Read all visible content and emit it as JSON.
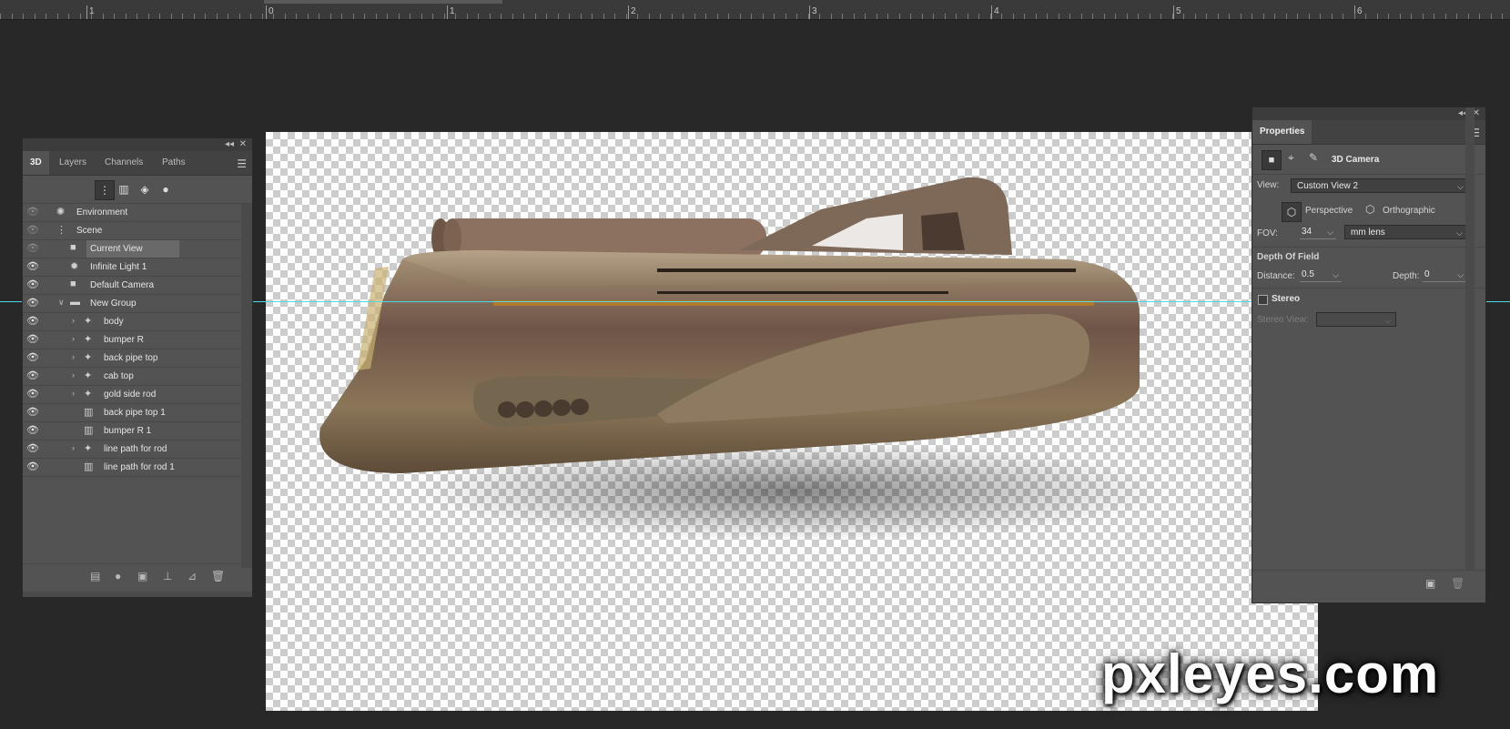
{
  "ruler": {
    "labels": [
      "1",
      "0",
      "1",
      "2",
      "3",
      "4",
      "5",
      "6"
    ]
  },
  "left_panel": {
    "tabs": [
      "3D",
      "Layers",
      "Channels",
      "Paths"
    ],
    "active_tab": "3D",
    "filter_icons": [
      "scene-filter-icon",
      "mesh-filter-icon",
      "material-filter-icon",
      "light-filter-icon"
    ],
    "layers": [
      {
        "name": "Environment",
        "icon": "environment-icon",
        "visible": "dim",
        "indent": 0,
        "expandable": false
      },
      {
        "name": "Scene",
        "icon": "scene-icon",
        "visible": "dim",
        "indent": 0,
        "expandable": false
      },
      {
        "name": "Current View",
        "icon": "camera-icon",
        "visible": "dim",
        "indent": 1,
        "expandable": false,
        "selected": true
      },
      {
        "name": "Infinite Light 1",
        "icon": "light-icon",
        "visible": "on",
        "indent": 1,
        "expandable": false
      },
      {
        "name": "Default Camera",
        "icon": "camera-icon",
        "visible": "on",
        "indent": 1,
        "expandable": false
      },
      {
        "name": "New Group",
        "icon": "folder-icon",
        "visible": "on",
        "indent": 1,
        "expandable": true,
        "expanded": true
      },
      {
        "name": "body",
        "icon": "mesh-icon",
        "visible": "on",
        "indent": 2,
        "expandable": true
      },
      {
        "name": "bumper R",
        "icon": "mesh-icon",
        "visible": "on",
        "indent": 2,
        "expandable": true
      },
      {
        "name": "back pipe top",
        "icon": "mesh-icon",
        "visible": "on",
        "indent": 2,
        "expandable": true
      },
      {
        "name": "cab top",
        "icon": "mesh-icon",
        "visible": "on",
        "indent": 2,
        "expandable": true
      },
      {
        "name": "gold side rod",
        "icon": "mesh-icon",
        "visible": "on",
        "indent": 2,
        "expandable": true
      },
      {
        "name": "back pipe top 1",
        "icon": "instance-icon",
        "visible": "on",
        "indent": 2,
        "expandable": false
      },
      {
        "name": "bumper R 1",
        "icon": "instance-icon",
        "visible": "on",
        "indent": 2,
        "expandable": false
      },
      {
        "name": "line path for rod",
        "icon": "mesh-icon",
        "visible": "on",
        "indent": 2,
        "expandable": true
      },
      {
        "name": "line path for rod 1",
        "icon": "instance-icon",
        "visible": "on",
        "indent": 2,
        "expandable": false
      }
    ],
    "bottom_icons": [
      "new-mesh-icon",
      "new-light-icon",
      "render-icon",
      "drop-to-plane-icon",
      "constraint-icon",
      "trash-icon"
    ]
  },
  "properties": {
    "tab": "Properties",
    "section_title": "3D Camera",
    "view_label": "View:",
    "view_value": "Custom View 2",
    "perspective_label": "Perspective",
    "orthographic_label": "Orthographic",
    "fov_label": "FOV:",
    "fov_value": "34",
    "lens_value": "mm lens",
    "dof_title": "Depth Of Field",
    "distance_label": "Distance:",
    "distance_value": "0.5",
    "depth_label": "Depth:",
    "depth_value": "0",
    "stereo_label": "Stereo",
    "stereo_view_label": "Stereo View:",
    "stereo_view_value": ""
  },
  "watermark": "pxleyes.com",
  "colors": {
    "background": "#282828",
    "panel": "#535353",
    "guide": "#4fd8e8",
    "selected_row": "#696969"
  }
}
